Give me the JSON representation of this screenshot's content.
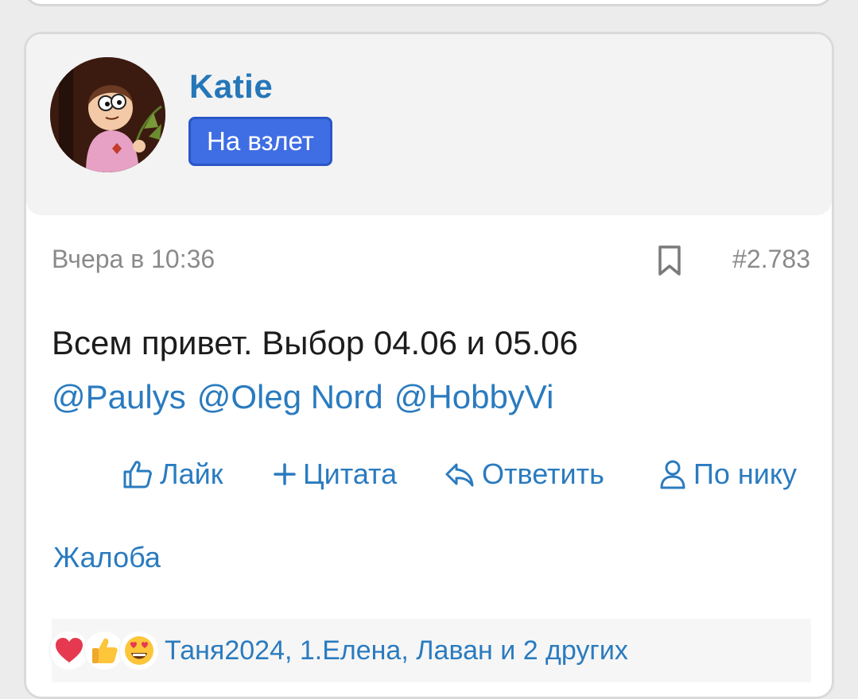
{
  "post": {
    "author": {
      "name": "Katie",
      "badge": "На взлет"
    },
    "date": "Вчера в 10:36",
    "number": "#2.783",
    "text": "Всем привет. Выбор 04.06 и 05.06",
    "mentions": [
      "@Paulys",
      "@Oleg Nord",
      "@HobbyVi"
    ],
    "actions": {
      "like": "Лайк",
      "quote": "Цитата",
      "reply": "Ответить",
      "by_nick": "По нику"
    },
    "complaint": "Жалоба",
    "reactions": {
      "icons": [
        "heart-icon",
        "thumbs-up-icon",
        "heart-eyes-icon"
      ],
      "users_text": "Таня2024, 1.Елена, Лаван и 2 других"
    }
  },
  "colors": {
    "link": "#2a7bbf",
    "badge": "#3f6de3",
    "username": "#2577b8"
  }
}
